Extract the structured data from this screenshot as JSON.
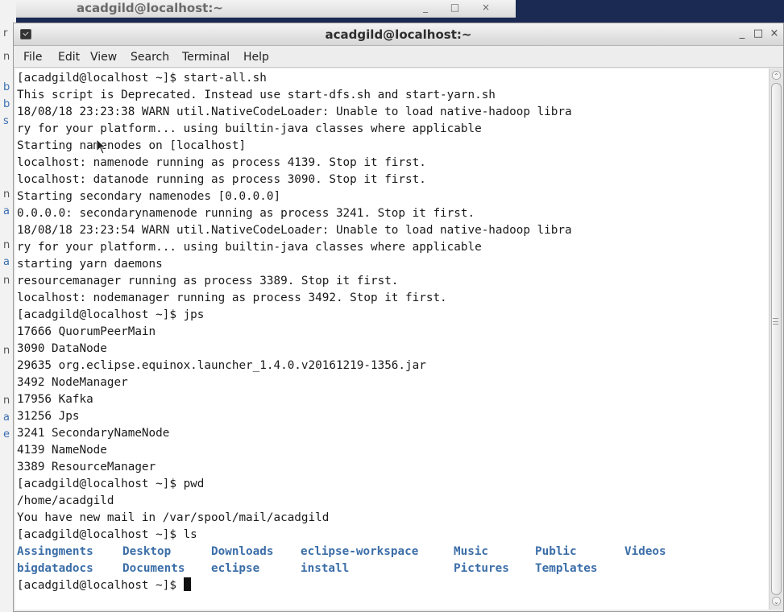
{
  "background_window": {
    "title": "acadgild@localhost:~",
    "controls": "_ □ ×",
    "edge_letters": [
      "r",
      "n",
      "b",
      "b",
      "s",
      "n",
      "a",
      "n",
      "a",
      "n",
      "n",
      "n",
      "a",
      "e"
    ]
  },
  "window": {
    "title": "acadgild@localhost:~",
    "minimize": "_",
    "maximize": "□",
    "close": "×"
  },
  "menu": [
    "File",
    "Edit",
    "View",
    "Search",
    "Terminal",
    "Help"
  ],
  "terminal": {
    "lines": [
      "[acadgild@localhost ~]$ start-all.sh",
      "This script is Deprecated. Instead use start-dfs.sh and start-yarn.sh",
      "18/08/18 23:23:38 WARN util.NativeCodeLoader: Unable to load native-hadoop libra",
      "ry for your platform... using builtin-java classes where applicable",
      "Starting namenodes on [localhost]",
      "localhost: namenode running as process 4139. Stop it first.",
      "localhost: datanode running as process 3090. Stop it first.",
      "Starting secondary namenodes [0.0.0.0]",
      "0.0.0.0: secondarynamenode running as process 3241. Stop it first.",
      "18/08/18 23:23:54 WARN util.NativeCodeLoader: Unable to load native-hadoop libra",
      "ry for your platform... using builtin-java classes where applicable",
      "starting yarn daemons",
      "resourcemanager running as process 3389. Stop it first.",
      "localhost: nodemanager running as process 3492. Stop it first.",
      "[acadgild@localhost ~]$ jps",
      "17666 QuorumPeerMain",
      "3090 DataNode",
      "29635 org.eclipse.equinox.launcher_1.4.0.v20161219-1356.jar",
      "3492 NodeManager",
      "17956 Kafka",
      "31256 Jps",
      "3241 SecondaryNameNode",
      "4139 NameNode",
      "3389 ResourceManager",
      "[acadgild@localhost ~]$ pwd",
      "/home/acadgild",
      "You have new mail in /var/spool/mail/acadgild",
      "[acadgild@localhost ~]$ ls"
    ],
    "ls_row1": [
      "Assingments",
      "Desktop",
      "Downloads",
      "eclipse-workspace",
      "Music",
      "Public",
      "Videos"
    ],
    "ls_row2": [
      "bigdatadocs",
      "Documents",
      "eclipse",
      "install",
      "Pictures",
      "Templates"
    ],
    "prompt": "[acadgild@localhost ~]$ ",
    "dir_color": "#3b6ea8"
  }
}
